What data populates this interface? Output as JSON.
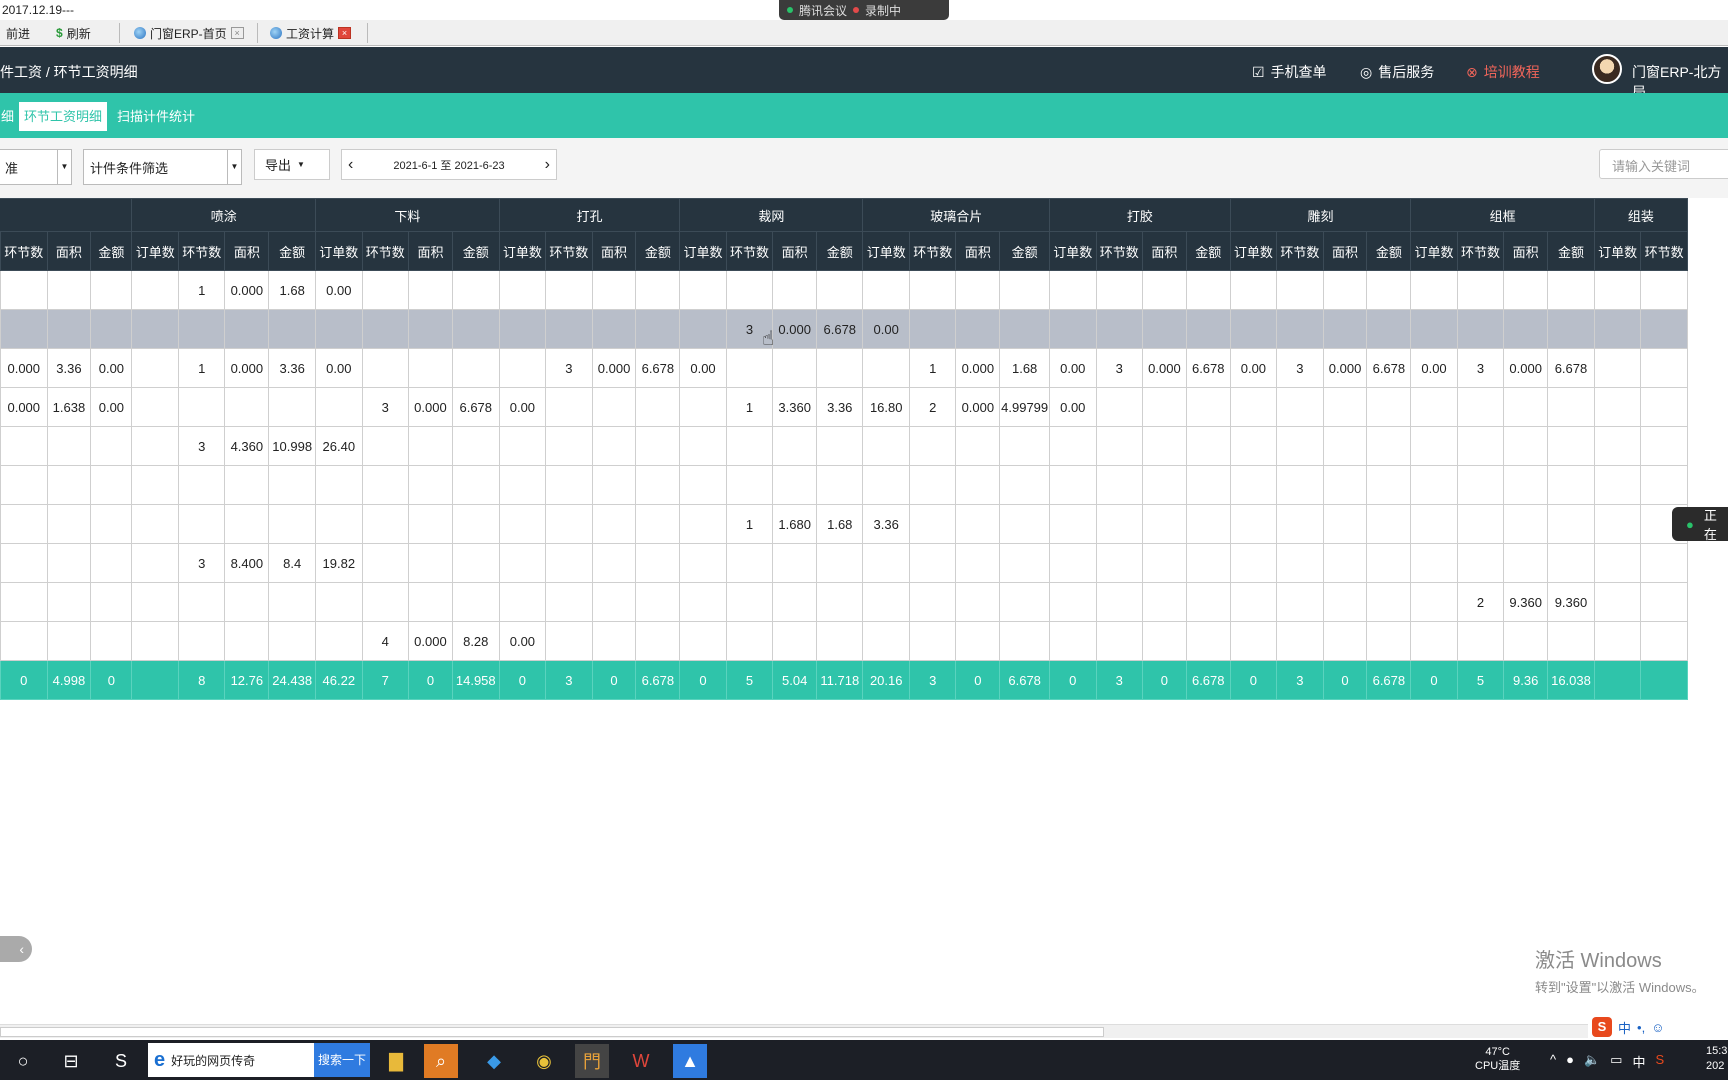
{
  "top": {
    "date": "2017.12.19---"
  },
  "meeting": {
    "app": "腾讯会议",
    "rec": "录制中"
  },
  "browser_tabs": [
    {
      "label": "前进"
    },
    {
      "label": "刷新"
    },
    {
      "label": "门窗ERP-首页"
    },
    {
      "label": "工资计算"
    }
  ],
  "header": {
    "breadcrumb": "件工资  /  环节工资明细",
    "mobile": "手机查单",
    "service": "售后服务",
    "training": "培训教程",
    "user": "门窗ERP-北方局"
  },
  "subtabs": [
    "细",
    "环节工资明细",
    "扫描计件统计"
  ],
  "toolbar": {
    "standard": "准",
    "filter": "计件条件筛选",
    "export": "导出",
    "date_range": "2021-6-1  至  2021-6-23",
    "search_placeholder": "请输入关键词"
  },
  "table": {
    "groups": [
      "",
      "喷涂",
      "下料",
      "打孔",
      "裁网",
      "玻璃合片",
      "打胶",
      "雕刻",
      "组框",
      "组装"
    ],
    "subheaders": [
      "订单数",
      "环节数",
      "面积",
      "金额"
    ],
    "rows": [
      [
        "",
        "",
        "",
        "",
        "",
        "1",
        "0.000",
        "1.68",
        "0.00",
        "",
        "",
        "",
        "",
        "",
        "",
        "",
        "",
        "",
        "",
        "",
        "",
        "",
        "",
        "",
        "",
        "",
        "",
        "",
        "",
        "",
        "",
        "",
        "",
        "",
        "",
        "",
        "",
        ""
      ],
      [
        "",
        "",
        "",
        "",
        "",
        "",
        "",
        "",
        "",
        "",
        "",
        "",
        "",
        "",
        "",
        "",
        "",
        "3",
        "0.000",
        "6.678",
        "0.00",
        "",
        "",
        "",
        "",
        "",
        "",
        "",
        "",
        "",
        "",
        "",
        "",
        "",
        "",
        "",
        "",
        ""
      ],
      [
        "",
        "0.000",
        "3.36",
        "0.00",
        "",
        "1",
        "0.000",
        "3.36",
        "0.00",
        "",
        "",
        "",
        "",
        "3",
        "0.000",
        "6.678",
        "0.00",
        "",
        "",
        "",
        "",
        "1",
        "0.000",
        "1.68",
        "0.00",
        "3",
        "0.000",
        "6.678",
        "0.00",
        "3",
        "0.000",
        "6.678",
        "0.00",
        "3",
        "0.000",
        "6.678",
        ""
      ],
      [
        "",
        "0.000",
        "1.638",
        "0.00",
        "",
        "",
        "",
        "",
        "",
        "3",
        "0.000",
        "6.678",
        "0.00",
        "",
        "",
        "",
        "",
        "1",
        "3.360",
        "3.36",
        "16.80",
        "2",
        "0.000",
        "4.99799",
        "0.00",
        "",
        "",
        "",
        "",
        "",
        "",
        "",
        "",
        "",
        "",
        "",
        ""
      ],
      [
        "",
        "",
        "",
        "",
        "",
        "3",
        "4.360",
        "10.998",
        "26.40",
        "",
        "",
        "",
        "",
        "",
        "",
        "",
        "",
        "",
        "",
        "",
        "",
        "",
        "",
        "",
        "",
        "",
        "",
        "",
        "",
        "",
        "",
        "",
        "",
        "",
        "",
        "",
        ""
      ],
      [
        "",
        "",
        "",
        "",
        "",
        "",
        "",
        "",
        "",
        "",
        "",
        "",
        "",
        "",
        "",
        "",
        "",
        "",
        "",
        "",
        "",
        "",
        "",
        "",
        "",
        "",
        "",
        "",
        "",
        "",
        "",
        "",
        "",
        "",
        "",
        "",
        ""
      ],
      [
        "",
        "",
        "",
        "",
        "",
        "",
        "",
        "",
        "",
        "",
        "",
        "",
        "",
        "",
        "",
        "",
        "",
        "1",
        "1.680",
        "1.68",
        "3.36",
        "",
        "",
        "",
        "",
        "",
        "",
        "",
        "",
        "",
        "",
        "",
        "",
        "",
        "",
        "",
        ""
      ],
      [
        "",
        "",
        "",
        "",
        "",
        "3",
        "8.400",
        "8.4",
        "19.82",
        "",
        "",
        "",
        "",
        "",
        "",
        "",
        "",
        "",
        "",
        "",
        "",
        "",
        "",
        "",
        "",
        "",
        "",
        "",
        "",
        "",
        "",
        "",
        "",
        "",
        "",
        "",
        ""
      ],
      [
        "",
        "",
        "",
        "",
        "",
        "",
        "",
        "",
        "",
        "",
        "",
        "",
        "",
        "",
        "",
        "",
        "",
        "",
        "",
        "",
        "",
        "",
        "",
        "",
        "",
        "",
        "",
        "",
        "",
        "",
        "",
        "",
        "",
        "2",
        "9.360",
        "9.360",
        ""
      ],
      [
        "",
        "",
        "",
        "",
        "",
        "",
        "",
        "",
        "",
        "4",
        "0.000",
        "8.28",
        "0.00",
        "",
        "",
        "",
        "",
        "",
        "",
        "",
        "",
        "",
        "",
        "",
        "",
        "",
        "",
        "",
        "",
        "",
        "",
        "",
        "",
        "",
        "",
        "",
        ""
      ]
    ],
    "total": [
      "",
      "0",
      "4.998",
      "0",
      "",
      "8",
      "12.76",
      "24.438",
      "46.22",
      "7",
      "0",
      "14.958",
      "0",
      "3",
      "0",
      "6.678",
      "0",
      "5",
      "5.04",
      "11.718",
      "20.16",
      "3",
      "0",
      "6.678",
      "0",
      "3",
      "0",
      "6.678",
      "0",
      "3",
      "0",
      "6.678",
      "0",
      "5",
      "9.36",
      "16.038",
      ""
    ]
  },
  "voice": {
    "label": "正在"
  },
  "activation": {
    "line1": "激活 Windows",
    "line2": "转到\"设置\"以激活 Windows。"
  },
  "ime": {
    "lang": "中"
  },
  "taskbar": {
    "search_text": "好玩的网页传奇",
    "search_button": "搜索一下",
    "temp": "47°C",
    "temp_label": "CPU温度",
    "lang": "中",
    "time": "15:3",
    "date": "202"
  },
  "colors": {
    "accent": "#2fc4aa",
    "header": "#26343f",
    "highlight_row": "#b8bec9"
  }
}
